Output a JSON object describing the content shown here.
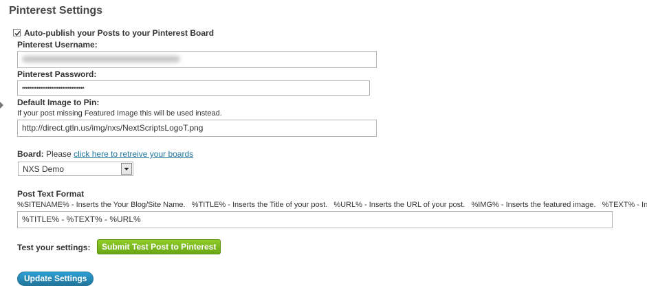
{
  "page": {
    "title": "Pinterest Settings"
  },
  "autopublish": {
    "label": "Auto-publish your Posts to your Pinterest Board",
    "checked": true
  },
  "username": {
    "label": "Pinterest Username:"
  },
  "password": {
    "label": "Pinterest Password:",
    "value": "••••••••••••••••••••••••••••••••••"
  },
  "default_image": {
    "label": "Default Image to Pin:",
    "help": "If your post missing Featured Image this will be used instead.",
    "value": "http://direct.gtln.us/img/nxs/NextScriptsLogoT.png"
  },
  "board": {
    "label": "Board:",
    "prompt": "Please",
    "link_text": "click here to retreive your boards",
    "selected": "NXS Demo"
  },
  "post_format": {
    "label": "Post Text Format",
    "help": "%SITENAME% - Inserts the Your Blog/Site Name.   %TITLE% - Inserts the Title of your post.   %URL% - Inserts the URL of your post.   %IMG% - Inserts the featured image.   %TEXT% - Inserts",
    "value": "%TITLE% - %TEXT% - %URL%"
  },
  "test": {
    "label": "Test your settings:",
    "button": "Submit Test Post to Pinterest"
  },
  "update_button": "Update Settings",
  "colors": {
    "link": "#21759b",
    "green_button": "#6aa616",
    "blue_button": "#21759b"
  }
}
